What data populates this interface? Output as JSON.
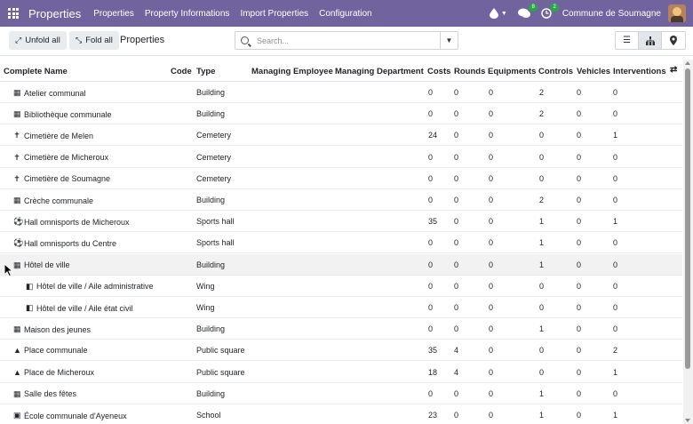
{
  "navbar": {
    "brand": "Properties",
    "menu": [
      "Properties",
      "Property Informations",
      "Import Properties",
      "Configuration"
    ],
    "activity_badge": "8",
    "clock_badge": "2",
    "company": "Commune de Soumagne"
  },
  "control": {
    "unfold_label": "Unfold all",
    "fold_label": "Fold all",
    "title": "Properties",
    "search_placeholder": "Search..."
  },
  "table": {
    "columns": [
      "Complete Name",
      "Code",
      "Type",
      "Managing Employee",
      "Managing Department",
      "Costs",
      "Rounds",
      "Equipments",
      "Controls",
      "Vehicles",
      "Interventions"
    ],
    "rows": [
      {
        "icon": "building-icon",
        "glyph": "▦",
        "name": "Atelier communal",
        "code": "",
        "type": "Building",
        "emp": "",
        "dept": "",
        "costs": "0",
        "rounds": "0",
        "equipments": "0",
        "controls": "2",
        "vehicles": "0",
        "interventions": "0"
      },
      {
        "icon": "building-icon",
        "glyph": "▦",
        "name": "Bibliothèque communale",
        "code": "",
        "type": "Building",
        "emp": "",
        "dept": "",
        "costs": "0",
        "rounds": "0",
        "equipments": "0",
        "controls": "2",
        "vehicles": "0",
        "interventions": "0"
      },
      {
        "icon": "cross-icon",
        "glyph": "✝",
        "name": "Cimetière de Melen",
        "code": "",
        "type": "Cemetery",
        "emp": "",
        "dept": "",
        "costs": "24",
        "rounds": "0",
        "equipments": "0",
        "controls": "0",
        "vehicles": "0",
        "interventions": "1"
      },
      {
        "icon": "cross-icon",
        "glyph": "✝",
        "name": "Cimetière de Micheroux",
        "code": "",
        "type": "Cemetery",
        "emp": "",
        "dept": "",
        "costs": "0",
        "rounds": "0",
        "equipments": "0",
        "controls": "0",
        "vehicles": "0",
        "interventions": "0"
      },
      {
        "icon": "cross-icon",
        "glyph": "✝",
        "name": "Cimetière de Soumagne",
        "code": "",
        "type": "Cemetery",
        "emp": "",
        "dept": "",
        "costs": "0",
        "rounds": "0",
        "equipments": "0",
        "controls": "0",
        "vehicles": "0",
        "interventions": "0"
      },
      {
        "icon": "building-icon",
        "glyph": "▦",
        "name": "Crèche communale",
        "code": "",
        "type": "Building",
        "emp": "",
        "dept": "",
        "costs": "0",
        "rounds": "0",
        "equipments": "0",
        "controls": "2",
        "vehicles": "0",
        "interventions": "0"
      },
      {
        "icon": "football-icon",
        "glyph": "⚽",
        "name": "Hall omnisports de Micheroux",
        "code": "",
        "type": "Sports hall",
        "emp": "",
        "dept": "",
        "costs": "35",
        "rounds": "0",
        "equipments": "0",
        "controls": "1",
        "vehicles": "0",
        "interventions": "1"
      },
      {
        "icon": "football-icon",
        "glyph": "⚽",
        "name": "Hall omnisports du Centre",
        "code": "",
        "type": "Sports hall",
        "emp": "",
        "dept": "",
        "costs": "0",
        "rounds": "0",
        "equipments": "0",
        "controls": "1",
        "vehicles": "0",
        "interventions": "0"
      },
      {
        "icon": "building-icon",
        "glyph": "▦",
        "name": "Hôtel de ville",
        "code": "",
        "type": "Building",
        "emp": "",
        "dept": "",
        "costs": "0",
        "rounds": "0",
        "equipments": "0",
        "controls": "1",
        "vehicles": "0",
        "interventions": "0",
        "indent": 0,
        "expanded": true,
        "hover": true
      },
      {
        "icon": "door-icon",
        "glyph": "◧",
        "name": "Hôtel de ville / Aile administrative",
        "code": "",
        "type": "Wing",
        "emp": "",
        "dept": "",
        "costs": "0",
        "rounds": "0",
        "equipments": "0",
        "controls": "0",
        "vehicles": "0",
        "interventions": "0",
        "indent": 1
      },
      {
        "icon": "door-icon",
        "glyph": "◧",
        "name": "Hôtel de ville / Aile état civil",
        "code": "",
        "type": "Wing",
        "emp": "",
        "dept": "",
        "costs": "0",
        "rounds": "0",
        "equipments": "0",
        "controls": "0",
        "vehicles": "0",
        "interventions": "0",
        "indent": 1
      },
      {
        "icon": "building-icon",
        "glyph": "▦",
        "name": "Maison des jeunes",
        "code": "",
        "type": "Building",
        "emp": "",
        "dept": "",
        "costs": "0",
        "rounds": "0",
        "equipments": "0",
        "controls": "1",
        "vehicles": "0",
        "interventions": "0"
      },
      {
        "icon": "bell-icon",
        "glyph": "▲",
        "name": "Place communale",
        "code": "",
        "type": "Public square",
        "emp": "",
        "dept": "",
        "costs": "35",
        "rounds": "4",
        "equipments": "0",
        "controls": "0",
        "vehicles": "0",
        "interventions": "2"
      },
      {
        "icon": "bell-icon",
        "glyph": "▲",
        "name": "Place de Micheroux",
        "code": "",
        "type": "Public square",
        "emp": "",
        "dept": "",
        "costs": "18",
        "rounds": "4",
        "equipments": "0",
        "controls": "0",
        "vehicles": "0",
        "interventions": "1"
      },
      {
        "icon": "building-icon",
        "glyph": "▦",
        "name": "Salle des fêtes",
        "code": "",
        "type": "Building",
        "emp": "",
        "dept": "",
        "costs": "0",
        "rounds": "0",
        "equipments": "0",
        "controls": "1",
        "vehicles": "0",
        "interventions": "0"
      },
      {
        "icon": "bus-icon",
        "glyph": "▣",
        "name": "École communale d'Ayeneux",
        "code": "",
        "type": "School",
        "emp": "",
        "dept": "",
        "costs": "23",
        "rounds": "0",
        "equipments": "0",
        "controls": "1",
        "vehicles": "0",
        "interventions": "1"
      }
    ]
  }
}
